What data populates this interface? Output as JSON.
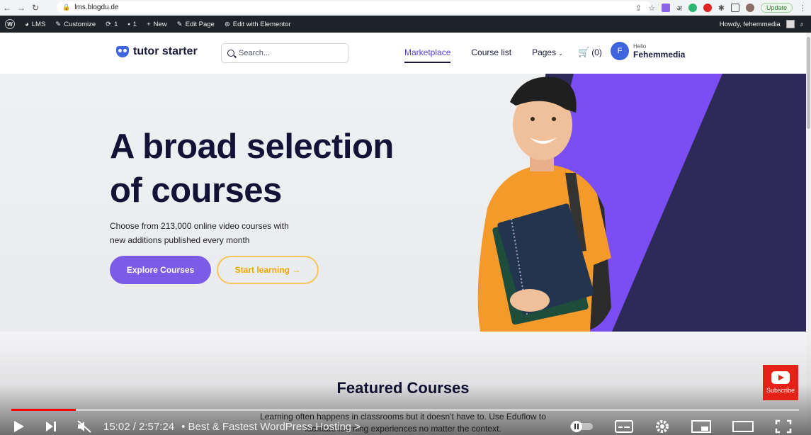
{
  "browser": {
    "url": "lms.blogdu.de",
    "update_label": "Update"
  },
  "wp_admin_bar": {
    "items": [
      {
        "label": "LMS"
      },
      {
        "label": "Customize"
      },
      {
        "label": "1"
      },
      {
        "label": "1"
      },
      {
        "label": "New"
      },
      {
        "label": "Edit Page"
      },
      {
        "label": "Edit with Elementor"
      }
    ],
    "greeting": "Howdy, fehemmedia"
  },
  "site": {
    "logo_text": "tutor starter",
    "search_placeholder": "Search...",
    "nav": [
      {
        "label": "Marketplace",
        "active": true
      },
      {
        "label": "Course list",
        "active": false
      },
      {
        "label": "Pages",
        "active": false
      }
    ],
    "cart_count": "(0)",
    "user_initial": "F",
    "user_hello": "Hello",
    "user_name": "Fehemmedia"
  },
  "hero": {
    "title_line1": "A broad selection",
    "title_line2": "of courses",
    "subtitle_line1": "Choose from 213,000 online video courses with",
    "subtitle_line2": "new additions published every month",
    "btn_primary": "Explore Courses",
    "btn_secondary": "Start learning →"
  },
  "featured": {
    "title": "Featured Courses",
    "subtitle_line1": "Learning often happens in classrooms but it doesn't have to. Use Eduflow to",
    "subtitle_line2": "facilitate learning experiences no matter the context."
  },
  "player": {
    "time": "15:02 / 2:57:24",
    "video_title": "• Best & Fastest WordPress Hosting >",
    "subscribe_label": "Subscribe",
    "progress_played": 0.082,
    "progress_buffered": 0.083
  },
  "colors": {
    "accent": "#7b5ce6",
    "nav_active": "#5b3fd8",
    "hero_purple": "#7a4ef4",
    "hero_dark": "#2e2a57",
    "secondary_button": "#f5c55b",
    "player_progress": "#ff0000"
  }
}
